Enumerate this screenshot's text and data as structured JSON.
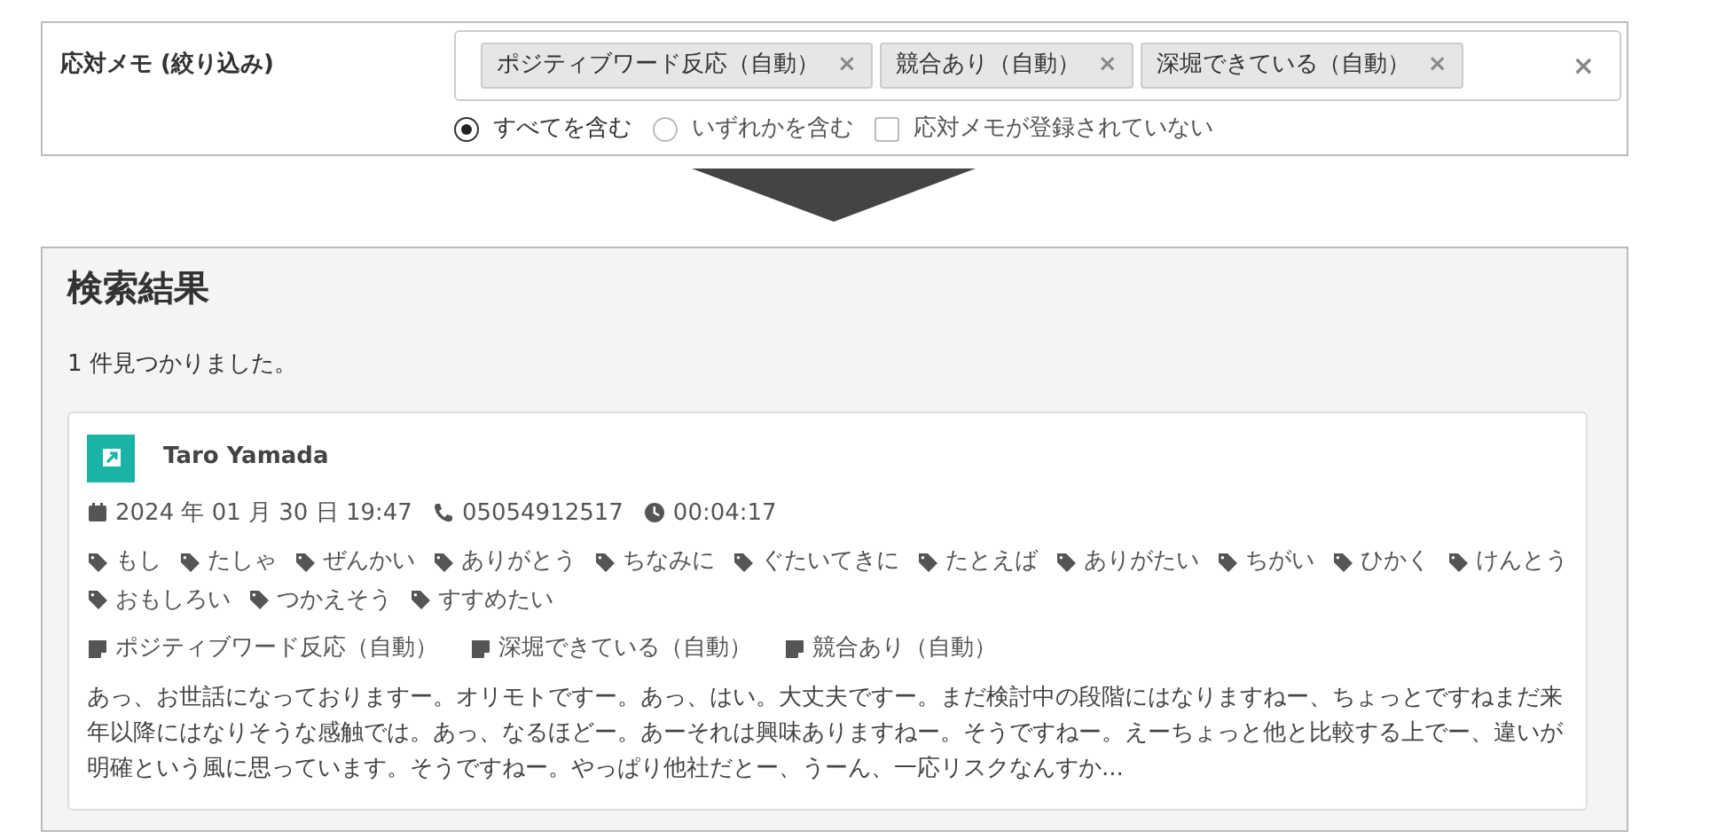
{
  "filter": {
    "label": "応対メモ (絞り込み)",
    "chips": [
      {
        "label": "ポジティブワード反応（自動）",
        "remove": "×"
      },
      {
        "label": "競合あり（自動）",
        "remove": "×"
      },
      {
        "label": "深堀できている（自動）",
        "remove": "×"
      }
    ],
    "clear": "×",
    "options": [
      {
        "kind": "radio",
        "label": "すべてを含む",
        "selected": true
      },
      {
        "kind": "radio",
        "label": "いずれかを含む",
        "selected": false
      },
      {
        "kind": "checkbox",
        "label": "応対メモが登録されていない",
        "checked": false
      }
    ]
  },
  "results": {
    "title": "検索結果",
    "count": "1 件見つかりました。",
    "items": [
      {
        "name": "Taro Yamada",
        "date": "2024 年 01 月 30 日 19:47",
        "phone": "05054912517",
        "duration": "00:04:17",
        "keywords": [
          "もし",
          "たしゃ",
          "ぜんかい",
          "ありがとう",
          "ちなみに",
          "ぐたいてきに",
          "たとえば",
          "ありがたい",
          "ちがい",
          "ひかく",
          "けんとう",
          "おもしろい",
          "つかえそう",
          "すすめたい"
        ],
        "memos": [
          "ポジティブワード反応（自動）",
          "深堀できている（自動）",
          "競合あり（自動）"
        ],
        "transcript": "あっ、お世話になっておりますー。オリモトですー。あっ、はい。大丈夫ですー。まだ検討中の段階にはなりますねー、ちょっとですねまだ来年以降にはなりそうな感触では。あっ、なるほどー。あーそれは興味ありますねー。そうですねー。えーちょっと他と比較する上でー、違いが明確という風に思っています。そうですねー。やっぱり他社だとー、うーん、一応リスクなんすか..."
      }
    ]
  }
}
